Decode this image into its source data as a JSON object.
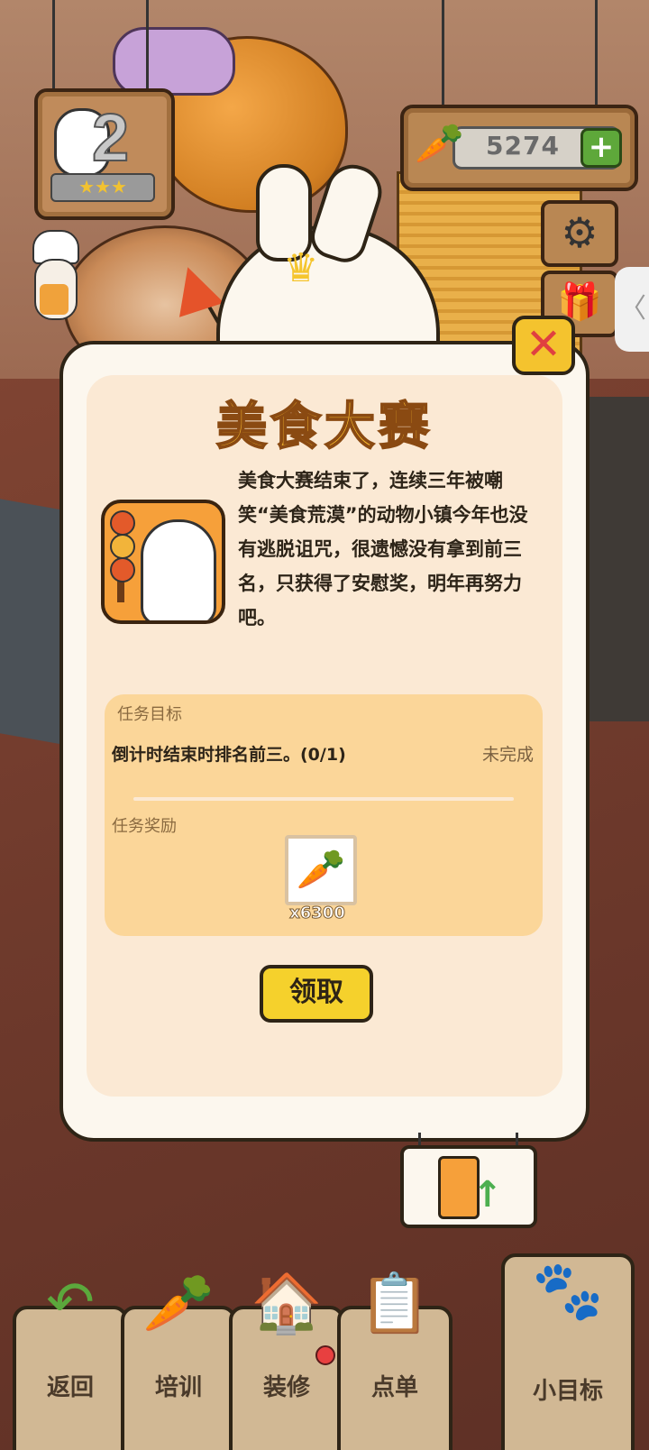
{
  "hud": {
    "level_number": "2",
    "level_stars": "★★★",
    "carrot_count": "5274",
    "add_symbol": "+"
  },
  "icons": {
    "carrot": "🥕",
    "gear": "⚙",
    "gift": "🎁",
    "crown": "♛",
    "close": "✕",
    "side_arrow": "〈",
    "back": "↶",
    "train": "🥕",
    "decor": "🏠",
    "order": "📋",
    "goal": "🐾"
  },
  "modal": {
    "title": "美食大赛",
    "story": "美食大赛结束了，连续三年被嘲笑“美食荒漠”的动物小镇今年也没有逃脱诅咒，很遗憾没有拿到前三名，只获得了安慰奖，明年再努力吧。",
    "task_label": "任务目标",
    "task_text": "倒计时结束时排名前三。(0/1)",
    "task_status": "未完成",
    "reward_label": "任务奖励",
    "reward_qty": "x6300",
    "claim_label": "领取"
  },
  "nav": {
    "back": "返回",
    "train": "培训",
    "decor": "装修",
    "order": "点单",
    "goal": "小目标"
  },
  "colors": {
    "title": "#f8ba2d",
    "panel": "#fcf7ee",
    "inner": "#fbe9d4",
    "task_box": "#fbd699",
    "claim_button": "#f5d12c",
    "close_button": "#f4c32e",
    "plus_button": "#5ea83a"
  }
}
